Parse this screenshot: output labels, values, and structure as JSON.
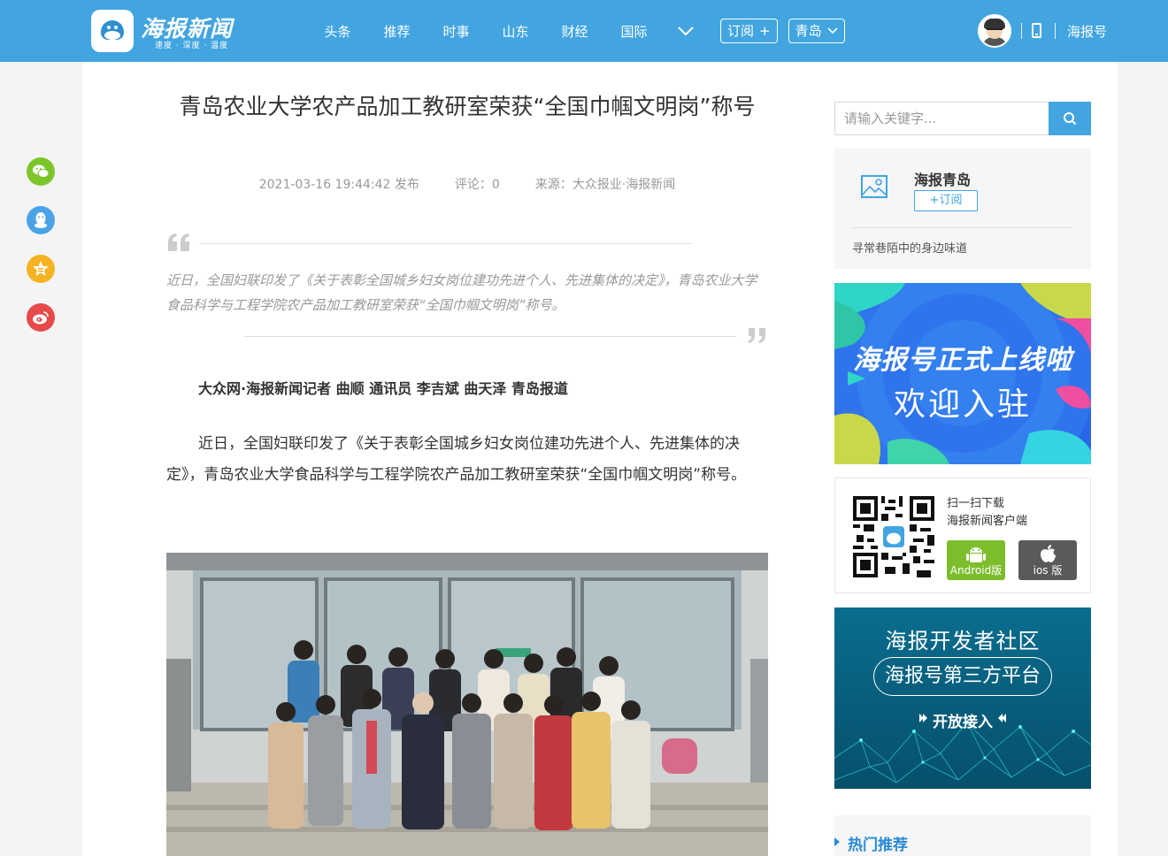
{
  "header": {
    "logo_title": "海报新闻",
    "logo_slogan": "速度 · 深度 · 温度",
    "nav": [
      "头条",
      "推荐",
      "时事",
      "山东",
      "财经",
      "国际"
    ],
    "subscribe_label": "订阅",
    "subscribe_plus": "+",
    "city_label": "青岛",
    "haibao_link": "海报号"
  },
  "article": {
    "title": "青岛农业大学农产品加工教研室荣获“全国巾帼文明岗”称号",
    "publish_time": "2021-03-16 19:44:42 发布",
    "comments": "评论：0",
    "source": "来源：大众报业·海报新闻",
    "summary": "近日，全国妇联印发了《关于表彰全国城乡妇女岗位建功先进个人、先进集体的决定》，青岛农业大学食品科学与工程学院农产品加工教研室荣获“全国巾帼文明岗”称号。",
    "byline": "大众网·海报新闻记者 曲顺 通讯员 李吉斌 曲天泽 青岛报道",
    "paragraph": "近日，全国妇联印发了《关于表彰全国城乡妇女岗位建功先进个人、先进集体的决定》，青岛农业大学食品科学与工程学院农产品加工教研室荣获“全国巾帼文明岗”称号。"
  },
  "sidebar": {
    "search_placeholder": "请输入关键字...",
    "channel": {
      "name": "海报青岛",
      "subscribe": "+订阅",
      "desc": "寻常巷陌中的身边味道"
    },
    "banner1": {
      "title": "海报号正式上线啦",
      "subtitle": "欢迎入驻"
    },
    "download": {
      "line1": "扫一扫下载",
      "line2": "海报新闻客户端",
      "android": "Android版",
      "ios": "ios 版"
    },
    "banner2": {
      "title": "海报开发者社区",
      "pill": "海报号第三方平台",
      "button": "开放接入"
    },
    "hot_title": "热门推荐"
  },
  "colors": {
    "brand_blue": "#42a5e0",
    "wechat_green": "#7cc62a",
    "qq_blue": "#4aa3e6",
    "qzone_yellow": "#f5b324",
    "weibo_red": "#e64a4a"
  },
  "icons": [
    "wechat-icon",
    "qq-icon",
    "qzone-icon",
    "weibo-icon",
    "search-icon",
    "phone-icon",
    "chevron-down-icon",
    "image-placeholder-icon",
    "android-icon",
    "apple-icon",
    "quote-open-icon",
    "quote-close-icon"
  ]
}
